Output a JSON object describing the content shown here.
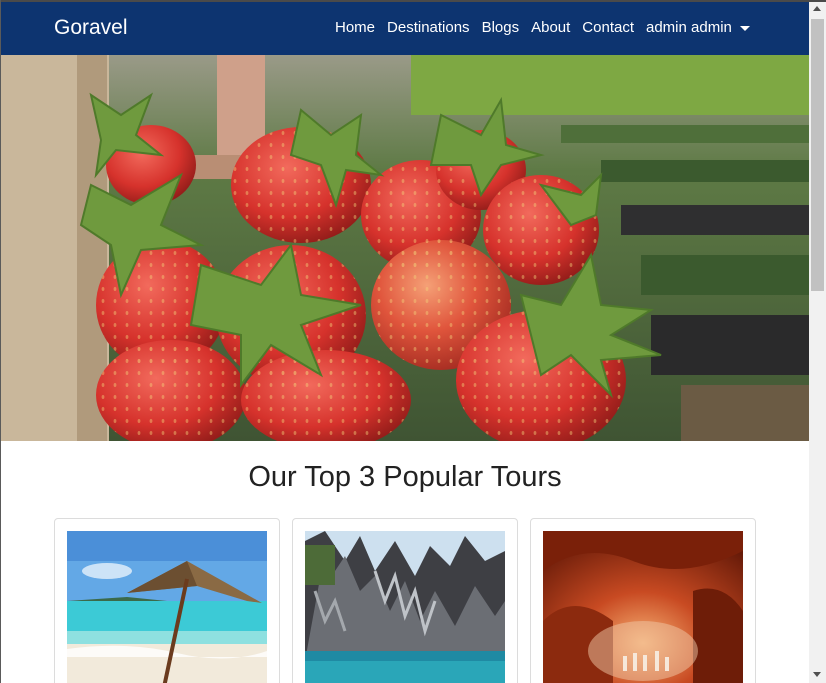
{
  "navbar": {
    "brand": "Goravel",
    "links": [
      "Home",
      "Destinations",
      "Blogs",
      "About",
      "Contact"
    ],
    "user_menu": "admin admin",
    "background": "#0d3470"
  },
  "hero": {
    "image": "strawberries-photo"
  },
  "tours": {
    "title": "Our Top 3 Popular Tours",
    "cards": [
      {
        "image": "beach-umbrella-photo"
      },
      {
        "image": "limestone-lagoon-photo"
      },
      {
        "image": "underground-cave-photo"
      }
    ]
  }
}
